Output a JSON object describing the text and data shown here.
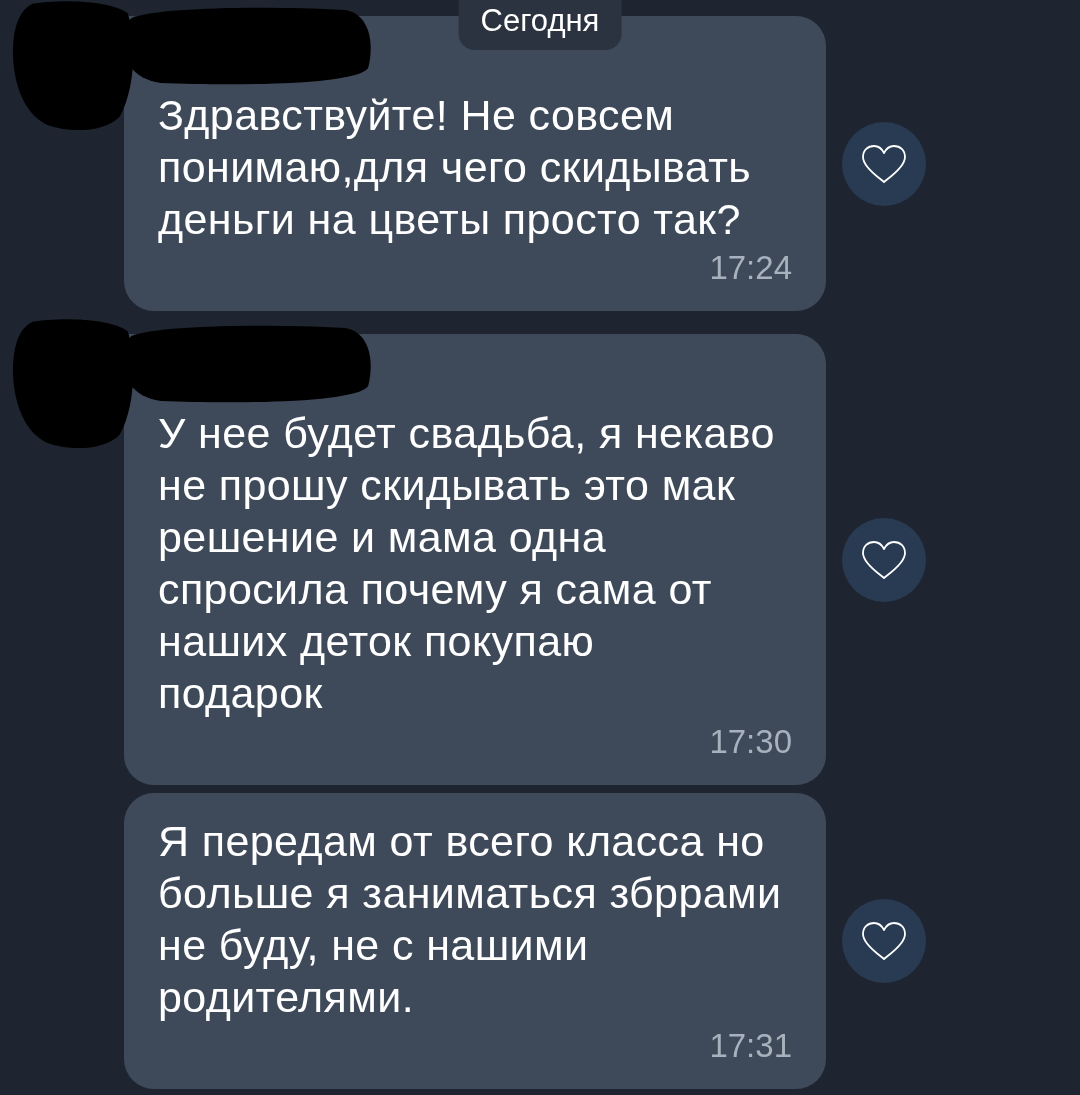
{
  "date_header": {
    "label": "Сегодня"
  },
  "messages": [
    {
      "sender_redacted": true,
      "text": "Здравствуйте! Не совсем\nпонимаю,для чего скидывать\nденьги на цветы просто так?",
      "time": "17:24",
      "liked": false
    },
    {
      "sender_redacted": true,
      "text": "У нее будет свадьба, я некаво\nне прошу скидывать это мак\nрешение и мама одна\nспросила почему я сама от\nнаших деток покупаю\nподарок",
      "time": "17:30",
      "liked": false
    },
    {
      "sender_redacted": false,
      "text": "Я передам от всего класса но\nбольше я заниматься збррами\nне буду, не с нашими\nродителями.",
      "time": "17:31",
      "liked": false
    }
  ]
}
